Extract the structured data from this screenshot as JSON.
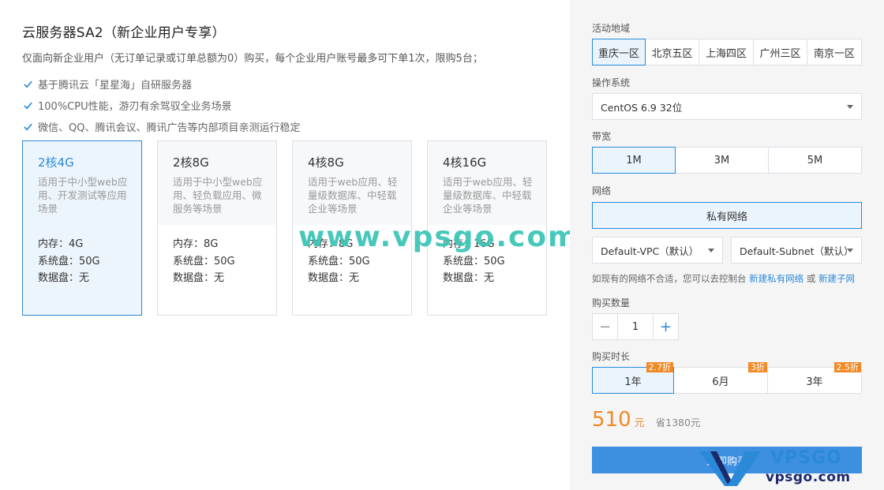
{
  "product": {
    "title": "云服务器SA2（新企业用户专享）",
    "subtitle": "仅面向新企业用户（无订单记录或订单总额为0）购买，每个企业用户账号最多可下单1次，限购5台；",
    "features": [
      "基于腾讯云「星星海」自研服务器",
      "100%CPU性能，游刃有余驾驭全业务场景",
      "微信、QQ、腾讯会议、腾讯广告等内部项目亲测运行稳定"
    ]
  },
  "cards": [
    {
      "name": "2核4G",
      "desc": "适用于中小型web应用、开发测试等应用场景",
      "mem": "内存：4G",
      "sys": "系统盘：50G",
      "data": "数据盘：无",
      "selected": true
    },
    {
      "name": "2核8G",
      "desc": "适用于中小型web应用、轻负载应用、微服务等场景",
      "mem": "内存：8G",
      "sys": "系统盘：50G",
      "data": "数据盘：无",
      "selected": false
    },
    {
      "name": "4核8G",
      "desc": "适用于web应用、轻量级数据库、中轻载企业等场景",
      "mem": "内存：8G",
      "sys": "系统盘：50G",
      "data": "数据盘：无",
      "selected": false
    },
    {
      "name": "4核16G",
      "desc": "适用于web应用、轻量级数据库、中轻载企业等场景",
      "mem": "内存：16G",
      "sys": "系统盘：50G",
      "data": "数据盘：无",
      "selected": false
    }
  ],
  "watermark": "www.vpsgo.com",
  "config": {
    "region_label": "活动地域",
    "regions": [
      "重庆一区",
      "北京五区",
      "上海四区",
      "广州三区",
      "南京一区"
    ],
    "os_label": "操作系统",
    "os_value": "CentOS 6.9 32位",
    "bandwidth_label": "带宽",
    "bandwidths": [
      "1M",
      "3M",
      "5M"
    ],
    "network_label": "网络",
    "network_button": "私有网络",
    "vpc_value": "Default-VPC（默认）",
    "subnet_value": "Default-Subnet（默认）",
    "hint_prefix": "如现有的网络不合适，您可以去控制台",
    "hint_link1": "新建私有网络",
    "hint_or": "或",
    "hint_link2": "新建子网",
    "quantity_label": "购买数量",
    "quantity_minus": "−",
    "quantity_value": "1",
    "quantity_plus": "+",
    "duration_label": "购买时长",
    "durations": [
      {
        "label": "1年",
        "badge": "2.7折"
      },
      {
        "label": "6月",
        "badge": "3折"
      },
      {
        "label": "3年",
        "badge": "2.5折"
      }
    ],
    "price": "510",
    "price_unit": "元",
    "saving": "省1380元",
    "buy_label": "立即购买"
  },
  "logo": {
    "big": "VPSGO",
    "small": "vpsgo.com"
  },
  "colors": {
    "accent": "#2a8ad8",
    "price": "#f08a24",
    "watermark": "#3ec6b8"
  }
}
